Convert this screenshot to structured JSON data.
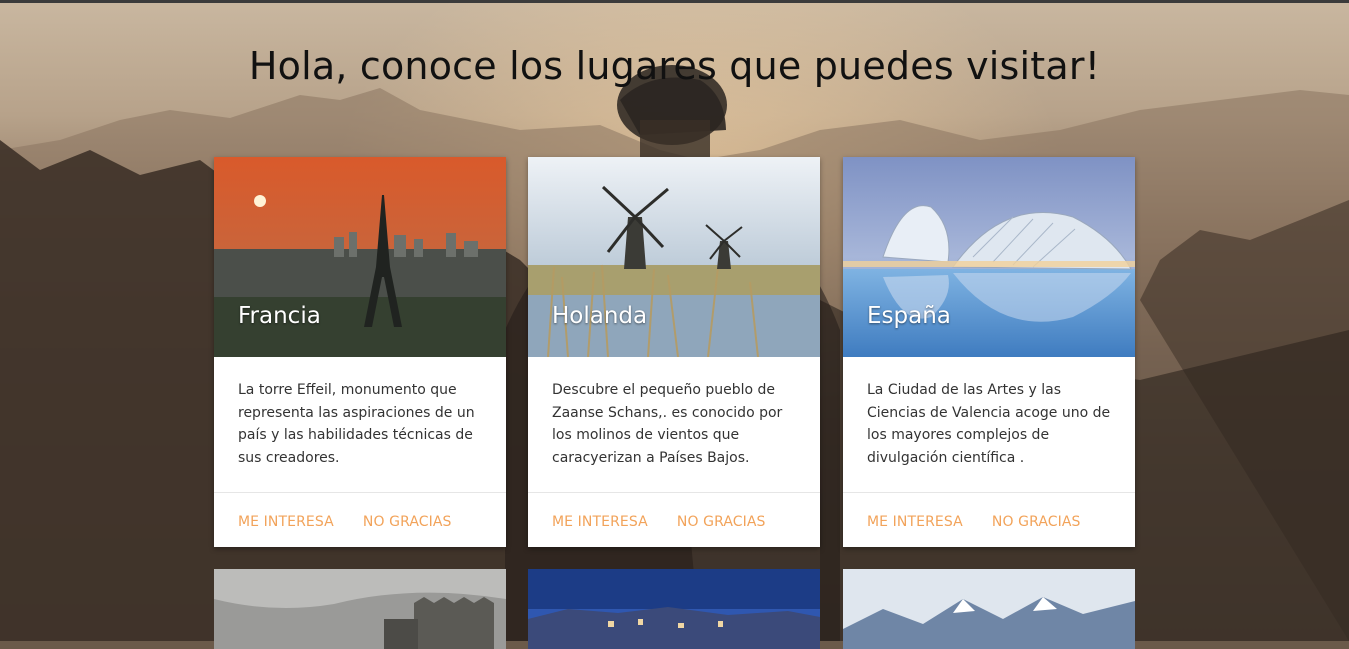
{
  "page_title": "Hola, conoce los lugares que puedes visitar!",
  "cards": [
    {
      "title": "Francia",
      "description": "La torre Effeil, monumento que representa las aspiraciones de un país y las habilidades técnicas de sus creadores.",
      "action_primary": "ME INTERESA",
      "action_secondary": "NO GRACIAS"
    },
    {
      "title": "Holanda",
      "description": "Descubre el pequeño pueblo de Zaanse Schans,. es conocido por los molinos de vientos que caracyerizan a Países Bajos.",
      "action_primary": "ME INTERESA",
      "action_secondary": "NO GRACIAS"
    },
    {
      "title": "España",
      "description": "La Ciudad de las Artes y las Ciencias de Valencia acoge uno de los mayores complejos de divulgación científica .",
      "action_primary": "ME INTERESA",
      "action_secondary": "NO GRACIAS"
    }
  ],
  "colors": {
    "action": "#f2a35a",
    "card_bg": "#ffffff",
    "title_text": "#111111"
  }
}
